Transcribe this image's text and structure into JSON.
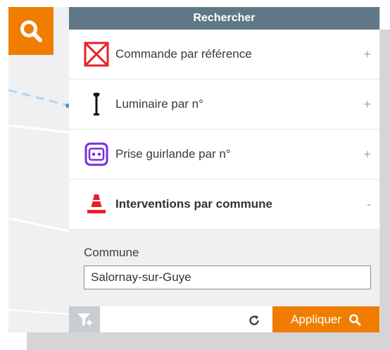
{
  "panel": {
    "title": "Rechercher"
  },
  "search_rows": [
    {
      "label": "Commande par référence",
      "toggle": "+",
      "icon": "command-reference-icon"
    },
    {
      "label": "Luminaire par n°",
      "toggle": "+",
      "icon": "street-light-icon"
    },
    {
      "label": "Prise guirlande par n°",
      "toggle": "+",
      "icon": "garland-socket-icon"
    },
    {
      "label": "Interventions par commune",
      "toggle": "-",
      "icon": "traffic-cone-icon"
    }
  ],
  "form": {
    "commune_label": "Commune",
    "commune_value": "Salornay-sur-Guye"
  },
  "footer": {
    "apply_label": "Appliquer"
  },
  "colors": {
    "accent": "#f07d00",
    "header": "#607786",
    "command_icon": "#e8202a",
    "socket_icon": "#7b2be0",
    "cone_icon": "#e8202a"
  }
}
